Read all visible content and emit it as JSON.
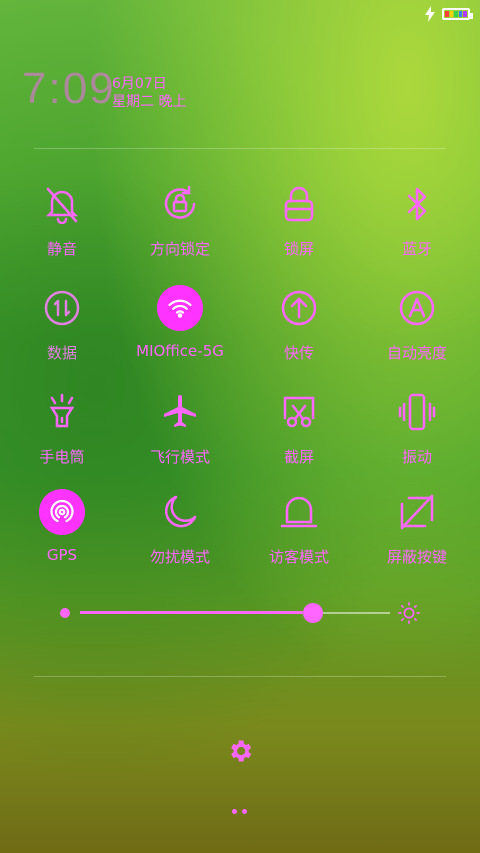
{
  "status_bar": {
    "charging_icon": "bolt-icon",
    "battery_icon": "battery-icon"
  },
  "header": {
    "time": "7:09",
    "date": "6月07日",
    "weekday_period": "星期二 晚上"
  },
  "toggles": [
    {
      "label": "静音",
      "icon": "bell-off-icon",
      "active": false
    },
    {
      "label": "方向锁定",
      "icon": "rotation-lock-icon",
      "active": false
    },
    {
      "label": "锁屏",
      "icon": "lock-icon",
      "active": false
    },
    {
      "label": "蓝牙",
      "icon": "bluetooth-icon",
      "active": false
    },
    {
      "label": "数据",
      "icon": "data-icon",
      "active": false
    },
    {
      "label": "MIOffice-5G",
      "icon": "wifi-icon",
      "active": true
    },
    {
      "label": "快传",
      "icon": "upload-icon",
      "active": false
    },
    {
      "label": "自动亮度",
      "icon": "auto-brightness-icon",
      "active": false
    },
    {
      "label": "手电筒",
      "icon": "flashlight-icon",
      "active": false
    },
    {
      "label": "飞行模式",
      "icon": "airplane-icon",
      "active": false
    },
    {
      "label": "截屏",
      "icon": "screenshot-icon",
      "active": false
    },
    {
      "label": "振动",
      "icon": "vibrate-icon",
      "active": false
    },
    {
      "label": "GPS",
      "icon": "gps-icon",
      "active": true
    },
    {
      "label": "勿扰模式",
      "icon": "moon-icon",
      "active": false
    },
    {
      "label": "访客模式",
      "icon": "guest-icon",
      "active": false
    },
    {
      "label": "屏蔽按键",
      "icon": "key-block-icon",
      "active": false
    }
  ],
  "brightness": {
    "level": 0.75,
    "min_icon": "dot-icon",
    "max_icon": "sun-icon"
  },
  "footer": {
    "settings_icon": "gear-icon",
    "pages": 2
  },
  "colors": {
    "accent": "#ff66ff",
    "active_bg": "#ff33ff"
  }
}
